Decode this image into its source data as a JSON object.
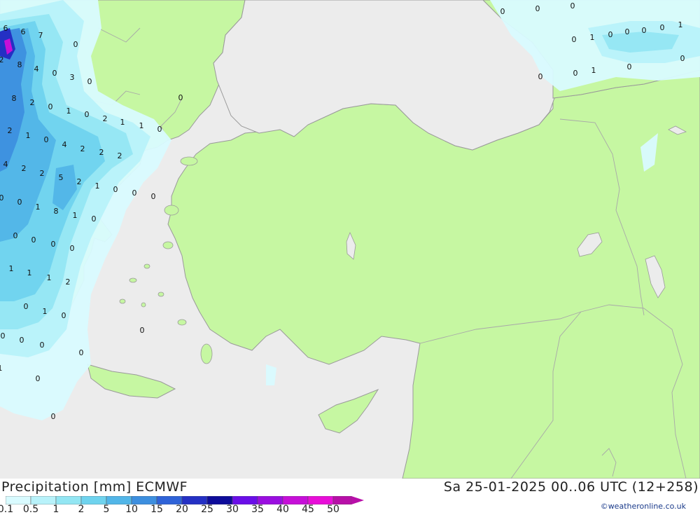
{
  "footer": {
    "title": "Precipitation [mm] ECMWF",
    "datetime": "Sa 25-01-2025 00..06 UTC (12+258)",
    "credit": "©weatheronline.co.uk"
  },
  "legend": [
    {
      "label": "0.1",
      "color": "#d9fbff"
    },
    {
      "label": "0.5",
      "color": "#b8f2fa"
    },
    {
      "label": "1",
      "color": "#93e6f3"
    },
    {
      "label": "2",
      "color": "#6fd3ee"
    },
    {
      "label": "5",
      "color": "#52b6e8"
    },
    {
      "label": "10",
      "color": "#3d8fdf"
    },
    {
      "label": "15",
      "color": "#2f63d8"
    },
    {
      "label": "20",
      "color": "#2430c4"
    },
    {
      "label": "25",
      "color": "#0e0c9a"
    },
    {
      "label": "30",
      "color": "#6a0ee8"
    },
    {
      "label": "35",
      "color": "#9a0ee0"
    },
    {
      "label": "40",
      "color": "#c60fd8"
    },
    {
      "label": "45",
      "color": "#e80ed8"
    },
    {
      "label": "50",
      "color": "#b80fa8"
    }
  ],
  "colors": {
    "land": "#c6f7a2",
    "sea": "#ececec",
    "coast": "#9a9a9a"
  },
  "precip_values": [
    "6",
    "6",
    "7",
    "0",
    "2",
    "8",
    "4",
    "0",
    "3",
    "0",
    "8",
    "2",
    "0",
    "1",
    "0",
    "2",
    "1",
    "1",
    "0",
    "2",
    "1",
    "0",
    "4",
    "2",
    "2",
    "2",
    "4",
    "2",
    "2",
    "5",
    "2",
    "1",
    "0",
    "0",
    "0",
    "0",
    "0",
    "1",
    "8",
    "1",
    "0",
    "0",
    "0",
    "0",
    "0",
    "1",
    "1",
    "1",
    "2",
    "0",
    "1",
    "0",
    "0",
    "0",
    "0",
    "0",
    "0",
    "0",
    "1",
    "0",
    "0",
    "0",
    "0",
    "0",
    "0",
    "1",
    "0",
    "0",
    "0",
    "0",
    "1",
    "0",
    "0",
    "1",
    "0",
    "0"
  ]
}
